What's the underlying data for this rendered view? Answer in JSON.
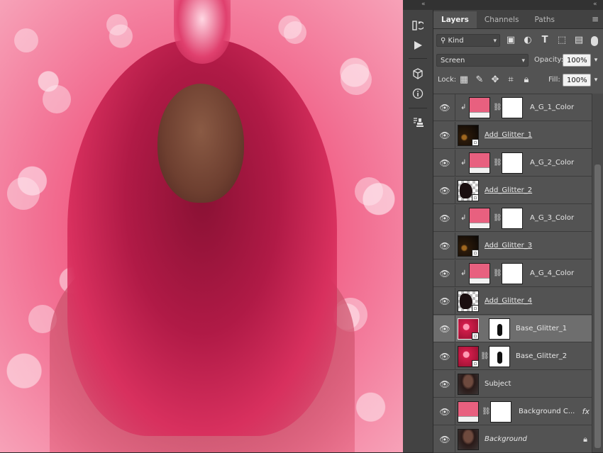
{
  "panel": {
    "tabs": [
      {
        "label": "Layers",
        "active": true
      },
      {
        "label": "Channels",
        "active": false
      },
      {
        "label": "Paths",
        "active": false
      }
    ],
    "filter_kind": "Kind",
    "blend_mode": "Screen",
    "opacity_label": "Opacity:",
    "opacity_value": "100%",
    "lock_label": "Lock:",
    "fill_label": "Fill:",
    "fill_value": "100%"
  },
  "icons": {
    "collapse": "«",
    "panel_menu": "≡",
    "history": "history-icon",
    "play": "play-icon",
    "cube": "3d-icon",
    "info": "info-icon",
    "stamp": "clone-source-icon"
  },
  "layers": [
    {
      "name": "A_G_1_Color",
      "kind": "fill",
      "clipped": true,
      "selected": false
    },
    {
      "name": "Add_Glitter_1",
      "kind": "smart-dark",
      "clipped": false,
      "selected": false
    },
    {
      "name": "A_G_2_Color",
      "kind": "fill",
      "clipped": true,
      "selected": false
    },
    {
      "name": "Add_Glitter_2",
      "kind": "smart-checker",
      "clipped": false,
      "selected": false
    },
    {
      "name": "A_G_3_Color",
      "kind": "fill",
      "clipped": true,
      "selected": false
    },
    {
      "name": "Add_Glitter_3",
      "kind": "smart-dark",
      "clipped": false,
      "selected": false
    },
    {
      "name": "A_G_4_Color",
      "kind": "fill",
      "clipped": true,
      "selected": false
    },
    {
      "name": "Add_Glitter_4",
      "kind": "smart-checker",
      "clipped": false,
      "selected": false
    },
    {
      "name": "Base_Glitter_1",
      "kind": "glitter-mask",
      "clipped": false,
      "selected": true
    },
    {
      "name": "Base_Glitter_2",
      "kind": "glitter-mask",
      "clipped": false,
      "selected": false
    },
    {
      "name": "Subject",
      "kind": "photo",
      "clipped": false,
      "selected": false
    },
    {
      "name": "Background C...",
      "kind": "fill-fx",
      "clipped": false,
      "selected": false
    },
    {
      "name": "Background",
      "kind": "background",
      "clipped": false,
      "selected": false
    }
  ],
  "colors": {
    "panel_bg": "#535353",
    "selected_row": "#6e6e6e",
    "fill_swatch": "#e8607f"
  }
}
